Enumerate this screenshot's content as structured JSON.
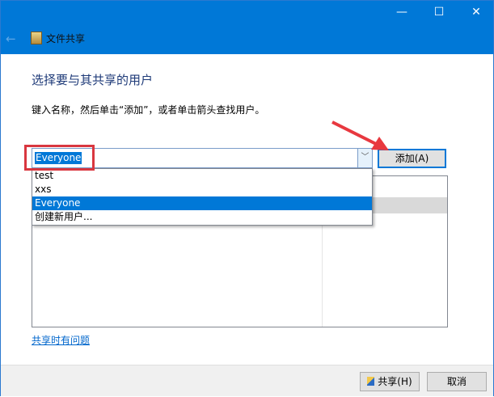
{
  "window": {
    "title": "文件共享",
    "minimize": "—",
    "maximize": "☐",
    "close": "✕",
    "back": "←"
  },
  "main": {
    "heading": "选择要与其共享的用户",
    "instruction": "键入名称，然后单击“添加”，或者单击箭头查找用户。"
  },
  "combo": {
    "value": "Everyone",
    "options": [
      "test",
      "xxs",
      "Everyone",
      "创建新用户..."
    ],
    "selected_index": 2,
    "chevron": "﹀"
  },
  "add_button": "添加(A)",
  "help_link": "共享时有问题",
  "footer": {
    "share_button": "共享(H)",
    "cancel_button": "取消"
  },
  "colors": {
    "accent": "#0078d7",
    "annotation": "#d9373f"
  }
}
